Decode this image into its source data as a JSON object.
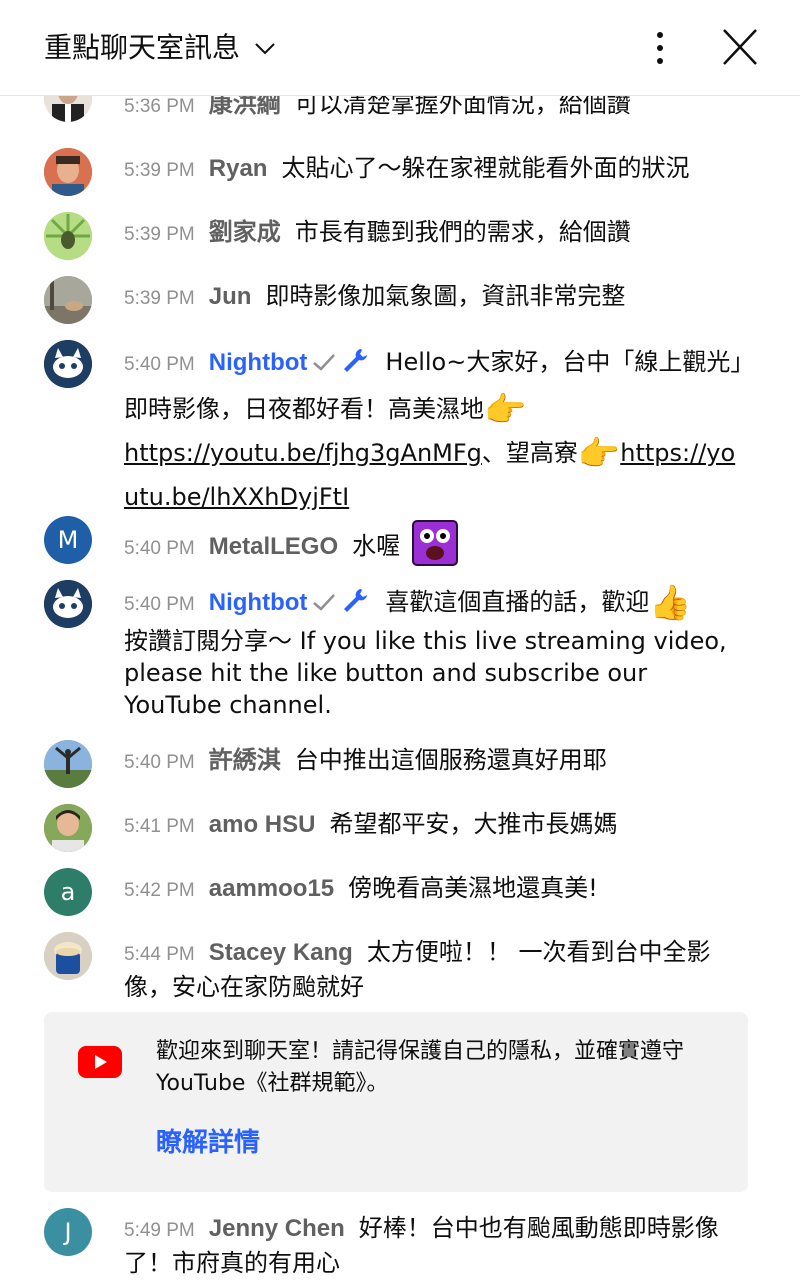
{
  "header": {
    "title": "重點聊天室訊息"
  },
  "messages": [
    {
      "time": "5:36 PM",
      "author": "康洪綱",
      "text": "可以清楚掌握外面情況，給個讚"
    },
    {
      "time": "5:39 PM",
      "author": "Ryan",
      "text": "太貼心了～躲在家裡就能看外面的狀況"
    },
    {
      "time": "5:39 PM",
      "author": "劉家成",
      "text": "市長有聽到我們的需求，給個讚"
    },
    {
      "time": "5:39 PM",
      "author": "Jun",
      "text": "即時影像加氣象圖，資訊非常完整"
    },
    {
      "time": "5:40 PM",
      "author": "Nightbot",
      "text_a": "Hello~大家好，台中「線上觀光」即時影像，日夜都好看！高美濕地",
      "link_a": "https://youtu.be/fjhg3gAnMFg",
      "text_b": "、望高寮",
      "link_b": "https://youtu.be/lhXXhDyjFtI"
    },
    {
      "time": "5:40 PM",
      "author": "MetalLEGO",
      "text": "水喔",
      "avatar_letter": "M",
      "avatar_color": "#1f5fa8"
    },
    {
      "time": "5:40 PM",
      "author": "Nightbot",
      "text_a": "喜歡這個直播的話，歡迎",
      "text_b": "按讚訂閱分享～ If you like this live streaming video, please hit the like button and subscribe our YouTube channel."
    },
    {
      "time": "5:40 PM",
      "author": "許綉淇",
      "text": "台中推出這個服務還真好用耶"
    },
    {
      "time": "5:41 PM",
      "author": "amo HSU",
      "text": "希望都平安，大推市長媽媽"
    },
    {
      "time": "5:42 PM",
      "author": "aammoo15",
      "text": "傍晚看高美濕地還真美!",
      "avatar_letter": "a",
      "avatar_color": "#2e7d68"
    },
    {
      "time": "5:44 PM",
      "author": "Stacey Kang",
      "text": "太方便啦！！ 一次看到台中全影像，安心在家防颱就好"
    },
    {
      "time": "5:49 PM",
      "author": "Jenny Chen",
      "text": "好棒！台中也有颱風動態即時影像了！市府真的有用心",
      "avatar_letter": "J",
      "avatar_color": "#3a8fa0"
    }
  ],
  "notice": {
    "text": "歡迎來到聊天室！請記得保護自己的隱私，並確實遵守 YouTube《社群規範》。",
    "learn_more": "瞭解詳情"
  },
  "colors": {
    "moderator": "#2962ff",
    "youtube_red": "#ff0000",
    "notice_bg": "#f2f2f2"
  }
}
